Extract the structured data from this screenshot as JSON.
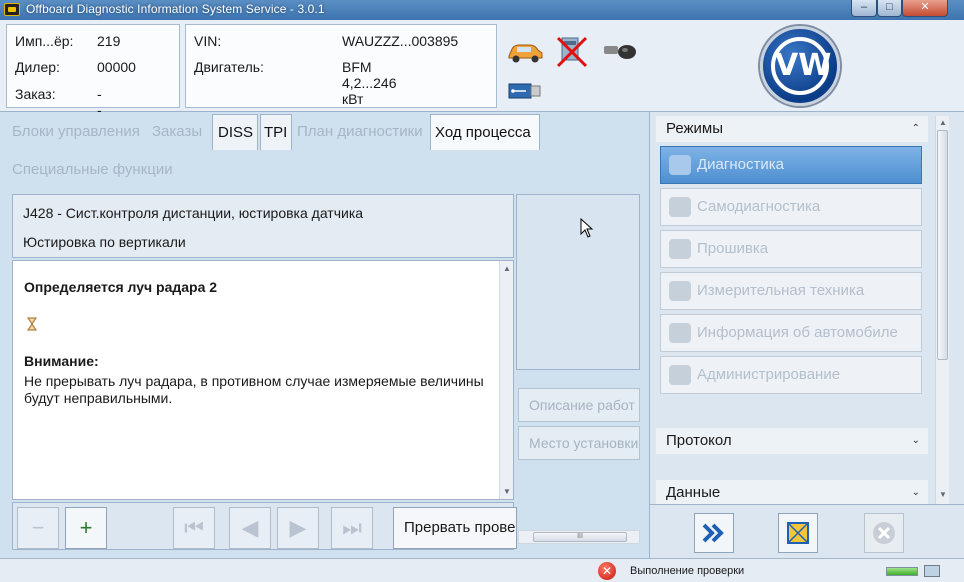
{
  "window": {
    "title": "Offboard Diagnostic Information System Service - 3.0.1",
    "min_glyph": "–",
    "max_glyph": "□",
    "close_glyph": "✕"
  },
  "header": {
    "importer_label": "Имп...ёр:",
    "importer_value": "219",
    "dealer_label": "Дилер:",
    "dealer_value": "00000",
    "order_label": "Заказ:",
    "order_value": "---",
    "vin_label": "VIN:",
    "vin_value": "WAUZZZ...003895",
    "engine_label": "Двигатель:",
    "engine_value": "BFM 4,2...246 кВт",
    "logo_text": "VW"
  },
  "tabs": [
    {
      "label": "Блоки управления"
    },
    {
      "label": "Заказы"
    },
    {
      "label": "DISS"
    },
    {
      "label": "TPI"
    },
    {
      "label": "План диагностики"
    },
    {
      "label": "Ход процесса"
    },
    {
      "label": "Специальные функции"
    }
  ],
  "panel": {
    "line1": "J428 - Сист.контроля дистанции, юстировка датчика",
    "line2": "Юстировка по вертикали",
    "heading": "Определяется луч радара 2",
    "warn_title": "Внимание:",
    "message": "Не прерывать луч радара, в противном случае измеряемые величины будут неправильными."
  },
  "side": {
    "btn1": "Описание работ",
    "btn2": "Место установки",
    "hscroll_grip": "III"
  },
  "toolbar": {
    "abort_label": "Прервать проверку",
    "zoom_out": "−",
    "zoom_in": "+",
    "first": "⏮",
    "prev": "◀",
    "next": "▶",
    "last": "⏭"
  },
  "modes": {
    "title": "Режимы",
    "collapse_glyph": "⌃",
    "items": [
      {
        "label": "Диагностика"
      },
      {
        "label": "Самодиагностика"
      },
      {
        "label": "Прошивка"
      },
      {
        "label": "Измерительная техника"
      },
      {
        "label": "Информация об автомобиле"
      },
      {
        "label": "Администрирование"
      }
    ],
    "protocol": "Протокол",
    "data": "Данные",
    "expand_glyph": "⌄"
  },
  "status": {
    "text": "Выполнение проверки",
    "err_glyph": "✕"
  }
}
